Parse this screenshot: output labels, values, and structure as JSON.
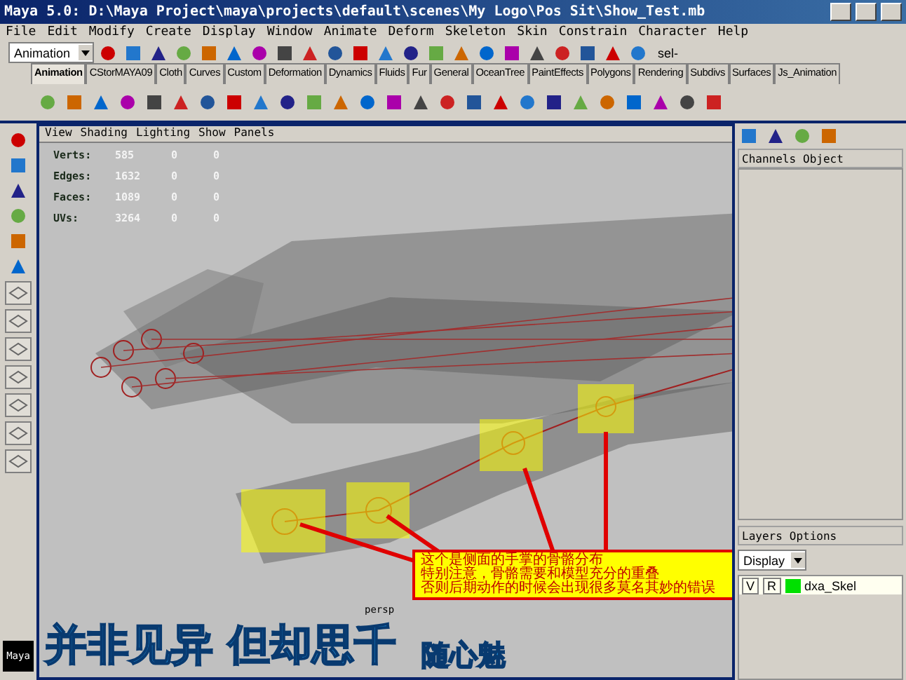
{
  "window": {
    "title": "Maya 5.0: D:\\Maya Project\\maya\\projects\\default\\scenes\\My Logo\\Pos Sit\\Show_Test.mb"
  },
  "menu": [
    "File",
    "Edit",
    "Modify",
    "Create",
    "Display",
    "Window",
    "Animate",
    "Deform",
    "Skeleton",
    "Skin",
    "Constrain",
    "Character",
    "Help"
  ],
  "status_line": {
    "mode": "Animation",
    "sel_label": "sel-"
  },
  "shelf_tabs": [
    {
      "label": "Animation",
      "selected": true
    },
    {
      "label": "CStorMAYA09",
      "selected": false
    },
    {
      "label": "Cloth",
      "selected": false
    },
    {
      "label": "Curves",
      "selected": false
    },
    {
      "label": "Custom",
      "selected": false
    },
    {
      "label": "Deformation",
      "selected": false
    },
    {
      "label": "Dynamics",
      "selected": false
    },
    {
      "label": "Fluids",
      "selected": false
    },
    {
      "label": "Fur",
      "selected": false
    },
    {
      "label": "General",
      "selected": false
    },
    {
      "label": "OceanTree",
      "selected": false
    },
    {
      "label": "PaintEffects",
      "selected": false
    },
    {
      "label": "Polygons",
      "selected": false
    },
    {
      "label": "Rendering",
      "selected": false
    },
    {
      "label": "Subdivs",
      "selected": false
    },
    {
      "label": "Surfaces",
      "selected": false
    },
    {
      "label": "Js_Animation",
      "selected": false
    }
  ],
  "viewport": {
    "menu": [
      "View",
      "Shading",
      "Lighting",
      "Show",
      "Panels"
    ],
    "stats": [
      {
        "label": "Verts:",
        "values": [
          "585",
          "0",
          "0"
        ]
      },
      {
        "label": "Edges:",
        "values": [
          "1632",
          "0",
          "0"
        ]
      },
      {
        "label": "Faces:",
        "values": [
          "1089",
          "0",
          "0"
        ]
      },
      {
        "label": "UVs:",
        "values": [
          "3264",
          "0",
          "0"
        ]
      }
    ],
    "camera": "persp",
    "annotation": [
      "这个是侧面的手掌的骨骼分布",
      "特别注意，骨骼需要和模型充分的重叠",
      "否则后期动作的时候会出现很多莫名其妙的错误"
    ],
    "slogan": "并非见异 但却思千",
    "signature": "随心魅"
  },
  "channel_box": {
    "menu": [
      "Channels",
      "Object"
    ]
  },
  "layers": {
    "menu": [
      "Layers",
      "Options"
    ],
    "display": "Display",
    "rows": [
      {
        "visible": "V",
        "render": "R",
        "color": "#00e000",
        "name": "dxa_Skel"
      }
    ]
  },
  "logo": "Maya"
}
